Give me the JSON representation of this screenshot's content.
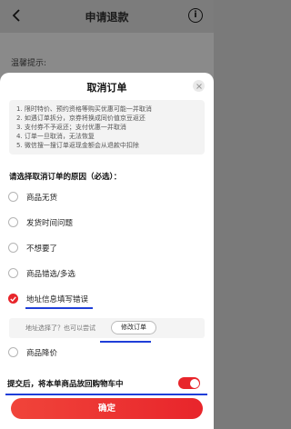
{
  "background_page": {
    "title": "申请退款",
    "tip_label": "温馨提示:",
    "info_icon_char": "i"
  },
  "sheet": {
    "title": "取消订单",
    "notices": [
      "1. 限时特价、预约资格等购买优惠可能一并取消",
      "2. 如遇订单拆分，京券将换成同价值京豆返还",
      "3. 支付券不予返还；支付优惠一并取消",
      "4. 订单一旦取消，无法恢复",
      "5. 微信搜一搜订单返现金额会从退款中扣除"
    ],
    "question": "请选择取消订单的原因（必选）：",
    "reasons": [
      {
        "label": "商品无货",
        "checked": false
      },
      {
        "label": "发货时间问题",
        "checked": false
      },
      {
        "label": "不想要了",
        "checked": false
      },
      {
        "label": "商品错选/多选",
        "checked": false
      },
      {
        "label": "地址信息填写错误",
        "checked": true
      },
      {
        "label": "商品降价",
        "checked": false
      }
    ],
    "hint": {
      "text": "地址选择了？也可以尝试",
      "button": "修改订单"
    },
    "toggle": {
      "label": "提交后，将本单商品放回购物车中",
      "on": true
    },
    "confirm_button": "确定"
  },
  "colors": {
    "accent_red": "#e8252b",
    "annotation_blue": "#1f3ed8"
  }
}
